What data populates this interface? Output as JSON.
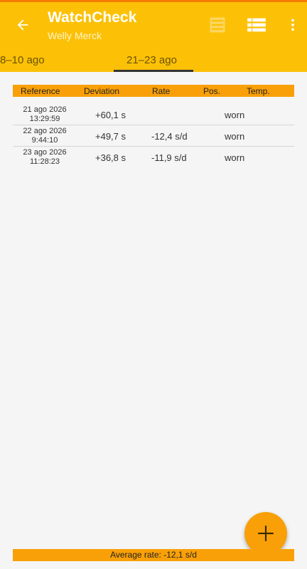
{
  "appbar": {
    "title": "WatchCheck",
    "subtitle": "Welly Merck",
    "back_icon": "arrow-left-icon",
    "list_icon_faded": "list-view-icon",
    "list_icon": "table-view-icon",
    "more_icon": "more-vert-icon"
  },
  "tabs": [
    {
      "label": "8–10 ago",
      "selected": false
    },
    {
      "label": "21–23 ago",
      "selected": true
    }
  ],
  "table": {
    "headers": [
      "Reference",
      "Deviation",
      "Rate",
      "Pos.",
      "Temp."
    ],
    "rows": [
      {
        "date": "21 ago 2026",
        "time": "13:29:59",
        "deviation": "+60,1 s",
        "rate": "",
        "position": "worn",
        "temp": ""
      },
      {
        "date": "22 ago 2026",
        "time": "9:44:10",
        "deviation": "+49,7 s",
        "rate": "-12,4 s/d",
        "position": "worn",
        "temp": ""
      },
      {
        "date": "23 ago 2026",
        "time": "11:28:23",
        "deviation": "+36,8 s",
        "rate": "-11,9 s/d",
        "position": "worn",
        "temp": ""
      }
    ]
  },
  "footer": {
    "average_rate": "Average rate: -12,1 s/d"
  },
  "fab": {
    "icon": "plus-icon"
  },
  "colors": {
    "appbar": "#fcc107",
    "accent": "#f9a008",
    "status_strip": "#f57c00"
  }
}
